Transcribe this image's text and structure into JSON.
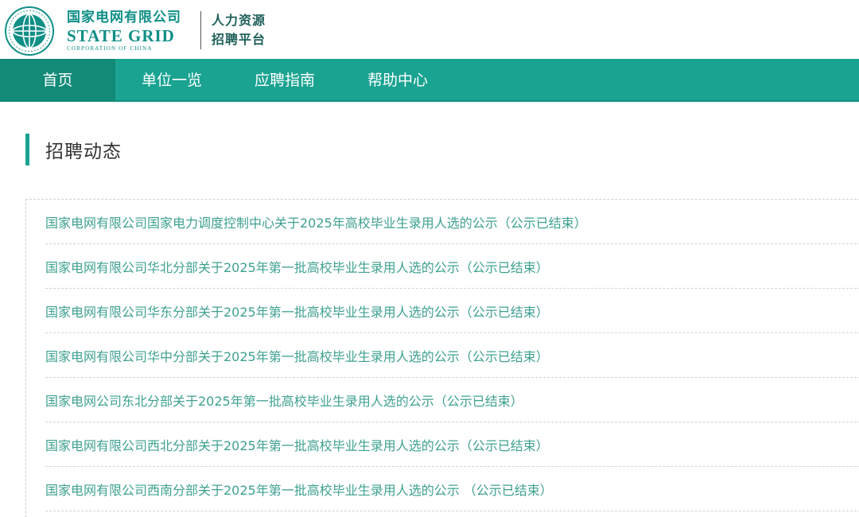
{
  "header": {
    "logo": {
      "cn_name": "国家电网有限公司",
      "en_name": "STATE GRID",
      "en_sub": "CORPORATION OF CHINA",
      "seal_text": "国家电网有限公司"
    },
    "platform": {
      "line1": "人力资源",
      "line2": "招聘平台"
    }
  },
  "nav": {
    "items": [
      {
        "label": "首页",
        "active": true
      },
      {
        "label": "单位一览",
        "active": false
      },
      {
        "label": "应聘指南",
        "active": false
      },
      {
        "label": "帮助中心",
        "active": false
      }
    ]
  },
  "section": {
    "title": "招聘动态"
  },
  "news": [
    "国家电网有限公司国家电力调度控制中心关于2025年高校毕业生录用人选的公示（公示已结束）",
    "国家电网有限公司华北分部关于2025年第一批高校毕业生录用人选的公示（公示已结束）",
    "国家电网有限公司华东分部关于2025年第一批高校毕业生录用人选的公示（公示已结束）",
    "国家电网有限公司华中分部关于2025年第一批高校毕业生录用人选的公示（公示已结束）",
    "国家电网公司东北分部关于2025年第一批高校毕业生录用人选的公示（公示已结束）",
    "国家电网有限公司西北分部关于2025年第一批高校毕业生录用人选的公示（公示已结束）",
    "国家电网有限公司西南分部关于2025年第一批高校毕业生录用人选的公示 （公示已结束）"
  ],
  "colors": {
    "brand_teal": "#1aa391",
    "nav_active": "#128a78",
    "link_green": "#3ea190"
  }
}
